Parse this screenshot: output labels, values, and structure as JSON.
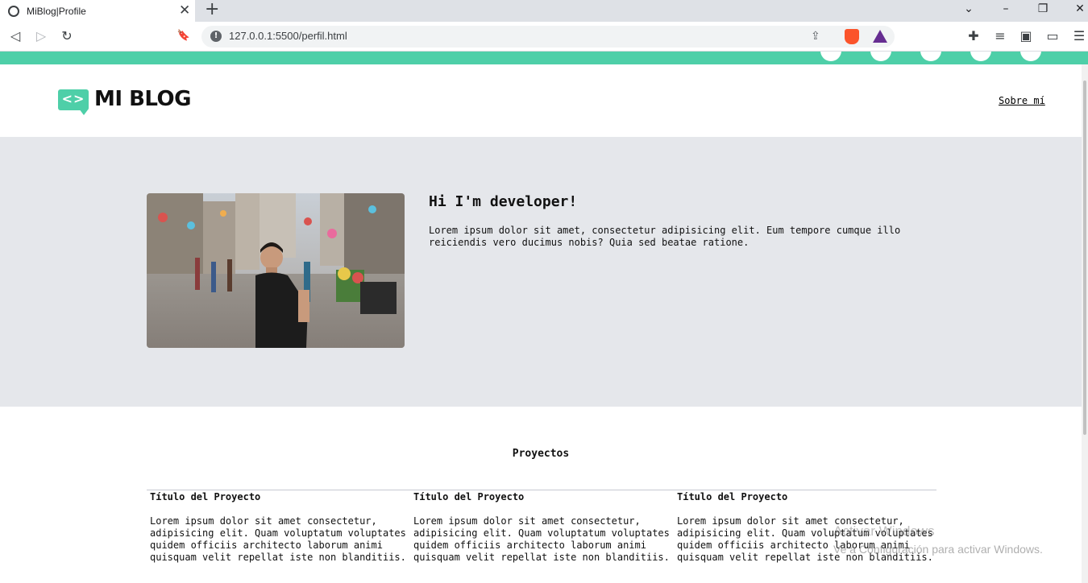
{
  "browser": {
    "tab_title": "MiBlog|Profile",
    "tab_close": "✕",
    "new_tab": "+",
    "url": "127.0.0.1:5500/perfil.html",
    "controls": {
      "chevron": "⌄",
      "minimize": "–",
      "restore": "❐",
      "close": "✕"
    },
    "nav": {
      "back": "◁",
      "forward": "▷",
      "reload": "↻",
      "bookmark": "🔖"
    },
    "right_icons": {
      "extensions": "✚",
      "playlist": "≡",
      "sidebar": "▣",
      "wallet": "▭",
      "menu": "☰",
      "share": "⇪"
    }
  },
  "header": {
    "logo_mark": "<>",
    "logo_text": "MI BLOG",
    "nav_link": "Sobre mí"
  },
  "hero": {
    "title": "Hi I'm developer!",
    "text": "Lorem ipsum dolor sit amet, consectetur adipisicing elit. Eum tempore cumque illo reiciendis vero ducimus nobis? Quia sed beatae ratione."
  },
  "projects": {
    "heading": "Proyectos",
    "items": [
      {
        "title": "Título del Proyecto",
        "text": "Lorem ipsum dolor sit amet consectetur, adipisicing elit. Quam voluptatum voluptates quidem officiis architecto laborum animi quisquam velit repellat iste non blanditiis."
      },
      {
        "title": "Título del Proyecto",
        "text": "Lorem ipsum dolor sit amet consectetur, adipisicing elit. Quam voluptatum voluptates quidem officiis architecto laborum animi quisquam velit repellat iste non blanditiis."
      },
      {
        "title": "Título del Proyecto",
        "text": "Lorem ipsum dolor sit amet consectetur, adipisicing elit. Quam voluptatum voluptates quidem officiis architecto laborum animi quisquam velit repellat iste non blanditiis."
      }
    ]
  },
  "watermark": {
    "line1": "Activar Windows",
    "line2": "Ve a Configuración para activar Windows."
  },
  "colors": {
    "accent": "#4ecfa8",
    "hero_bg": "#e5e7eb"
  }
}
